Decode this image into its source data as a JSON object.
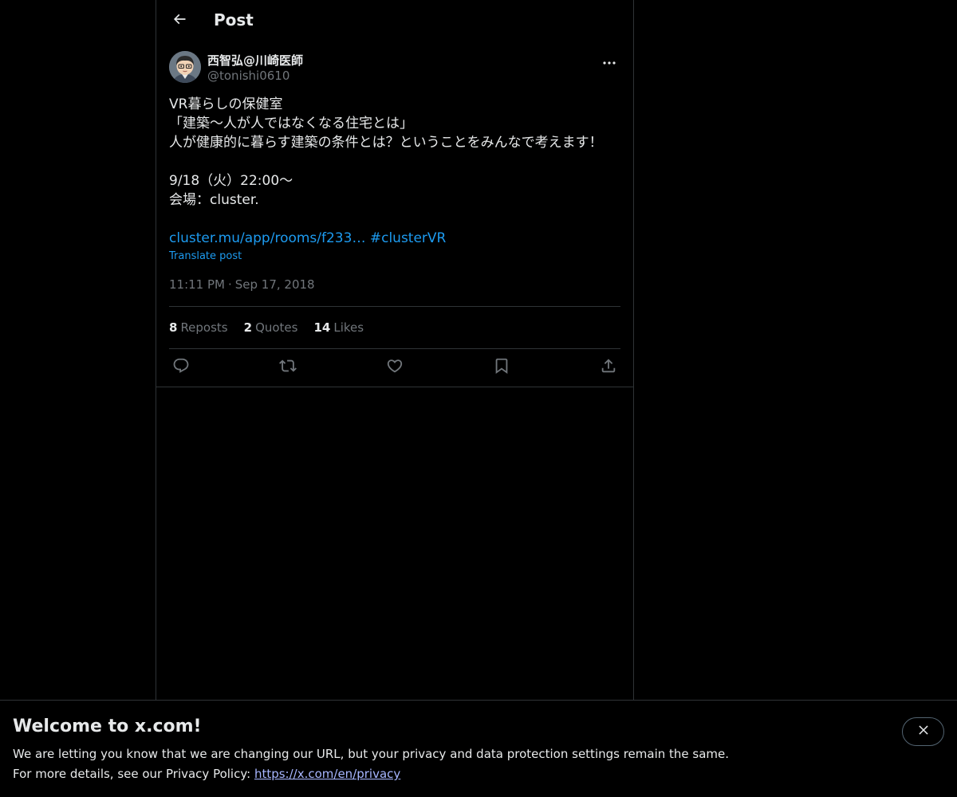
{
  "header": {
    "title": "Post",
    "back_icon": "arrow-left-icon"
  },
  "post": {
    "author_name": "西智弘@川崎医師",
    "author_handle": "@tonishi0610",
    "more_icon": "ellipsis-icon",
    "lines": [
      "VR暮らしの保健室",
      "「建築〜人が人ではなくなる住宅とは」",
      "人が健康的に暮らす建築の条件とは？ということをみんなで考えます！",
      "",
      "9/18（火）22:00〜",
      "会場：cluster."
    ],
    "link_url": "cluster.mu/app/rooms/f233…",
    "hashtag": "#clusterVR",
    "translate_label": "Translate post",
    "time": "11:11 PM",
    "date": "Sep 17, 2018",
    "separator": "·"
  },
  "stats": {
    "reposts_count": "8",
    "reposts_label": "Reposts",
    "quotes_count": "2",
    "quotes_label": "Quotes",
    "likes_count": "14",
    "likes_label": "Likes"
  },
  "actions": [
    {
      "icon": "reply-icon"
    },
    {
      "icon": "repost-icon"
    },
    {
      "icon": "like-icon"
    },
    {
      "icon": "bookmark-icon"
    },
    {
      "icon": "share-icon"
    }
  ],
  "banner": {
    "title": "Welcome to x.com!",
    "line1": "We are letting you know that we are changing our URL, but your privacy and data protection settings remain the same.",
    "line2_prefix": "For more details, see our Privacy Policy: ",
    "privacy_link": "https://x.com/en/privacy",
    "close_icon": "close-icon"
  },
  "colors": {
    "background": "#000000",
    "text": "#e7e9ea",
    "secondary_text": "#71767b",
    "link": "#1d9bf0",
    "border": "#2f3336"
  }
}
